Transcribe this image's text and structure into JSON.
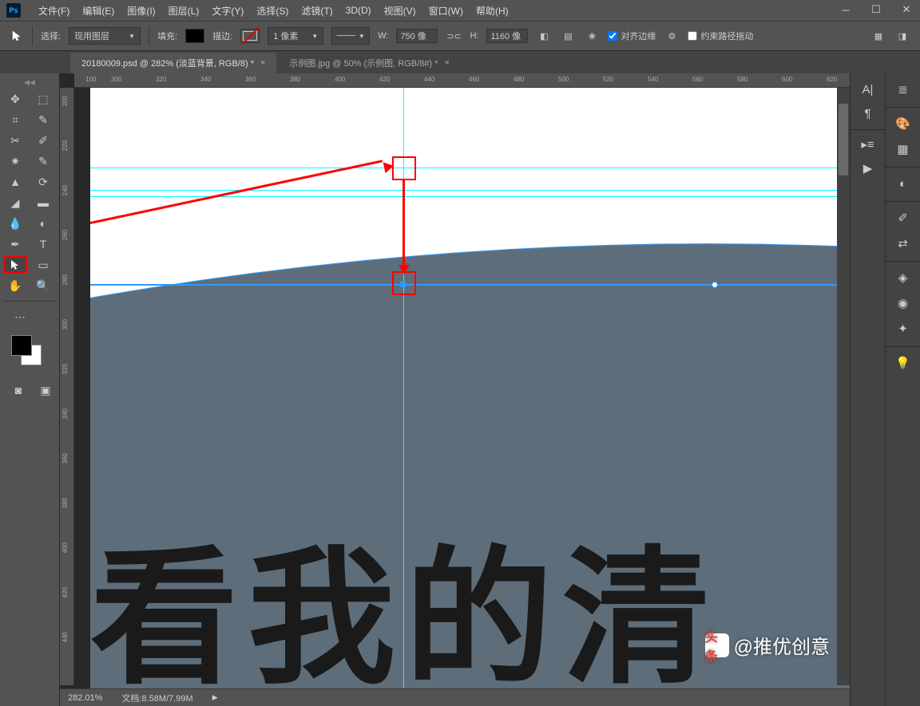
{
  "app": {
    "logo": "Ps"
  },
  "menu": {
    "file": "文件(F)",
    "edit": "编辑(E)",
    "image": "图像(I)",
    "layer": "图层(L)",
    "type": "文字(Y)",
    "select": "选择(S)",
    "filter": "滤镜(T)",
    "threeD": "3D(D)",
    "view": "视图(V)",
    "window": "窗口(W)",
    "help": "帮助(H)"
  },
  "options": {
    "select_label": "选择:",
    "select_value": "现用图层",
    "fill_label": "填充:",
    "stroke_label": "描边:",
    "stroke_width": "1 像素",
    "w_label": "W:",
    "w_value": "750 像",
    "h_label": "H:",
    "h_value": "1160 像",
    "align_edges": "对齐边缘",
    "constrain_path": "约束路径拖动"
  },
  "tabs": {
    "active": "20180009.psd @ 282% (淡蓝背景, RGB/8) *",
    "inactive": "示例图.jpg @ 50% (示例图, RGB/8#) *"
  },
  "ruler_h": {
    "100": "100",
    "300": "300",
    "320": "320",
    "340": "340",
    "360": "360",
    "380": "380",
    "400": "400",
    "420": "420",
    "440": "440",
    "460": "460",
    "480": "480",
    "500": "500",
    "520": "520",
    "540": "540",
    "560": "560",
    "580": "580",
    "600": "600",
    "620": "620"
  },
  "ruler_v": {
    "200": "200",
    "220": "220",
    "240": "240",
    "260": "260",
    "280": "280",
    "300": "300",
    "320": "320",
    "340": "340",
    "360": "360",
    "380": "380",
    "400": "400",
    "420": "420",
    "440": "440"
  },
  "canvas": {
    "brush_text": "看我的清"
  },
  "watermark": {
    "logo": "头条",
    "text": "@推优创意"
  },
  "status": {
    "zoom": "282.01%",
    "doc": "文档:8.58M/7.99M"
  }
}
